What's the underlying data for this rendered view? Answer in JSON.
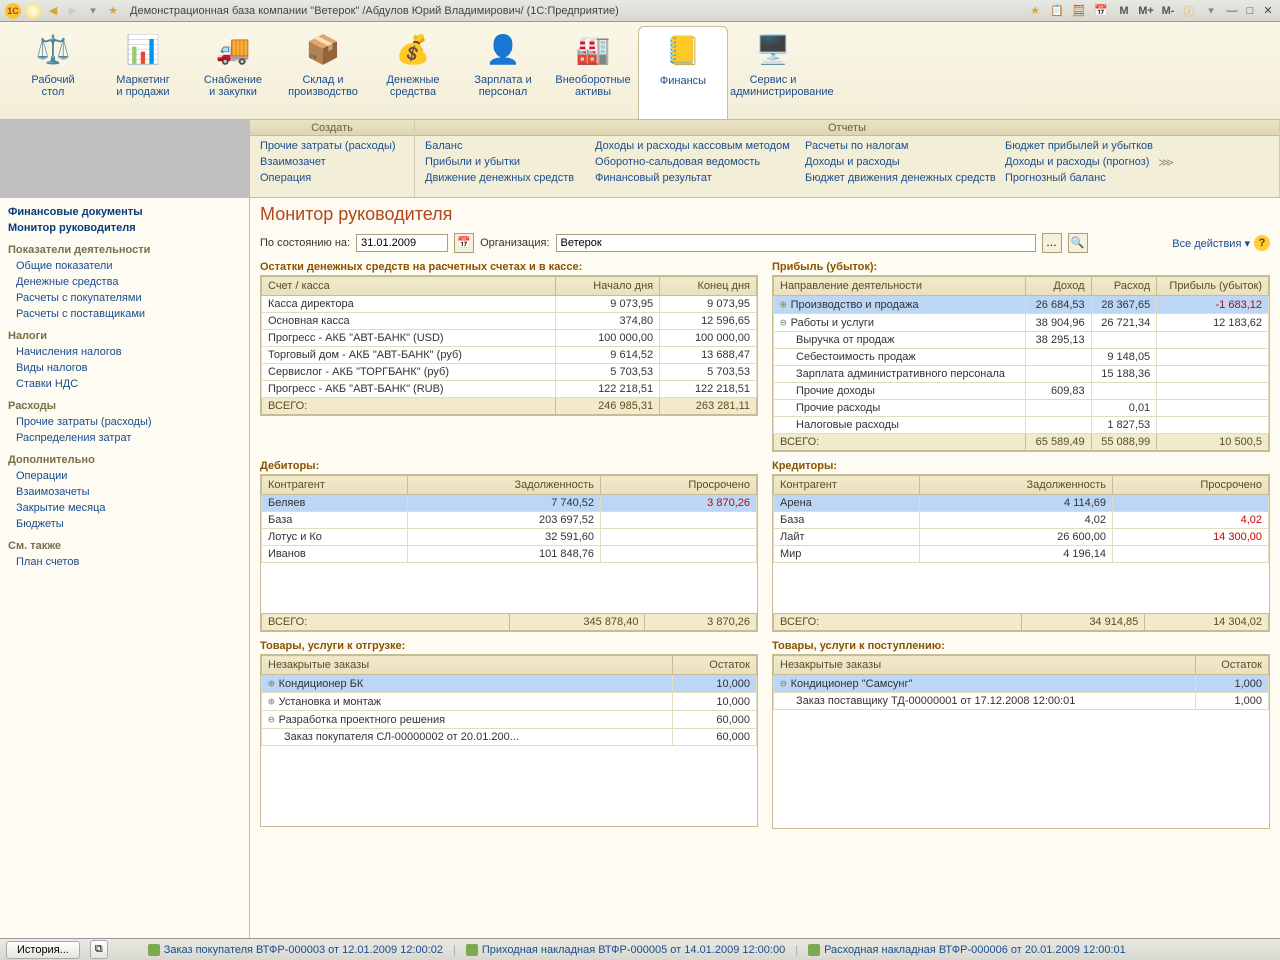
{
  "title": "Демонстрационная база компании \"Ветерок\" /Абдулов Юрий Владимирович/  (1С:Предприятие)",
  "titlebar": {
    "m": "M",
    "mp": "M+",
    "mm": "M-"
  },
  "sections": [
    {
      "label": "Рабочий\nстол",
      "icon": "⚖️"
    },
    {
      "label": "Маркетинг\nи продажи",
      "icon": "📊"
    },
    {
      "label": "Снабжение\nи закупки",
      "icon": "🚚"
    },
    {
      "label": "Склад и\nпроизводство",
      "icon": "📦"
    },
    {
      "label": "Денежные\nсредства",
      "icon": "💰"
    },
    {
      "label": "Зарплата и\nперсонал",
      "icon": "👤"
    },
    {
      "label": "Внеоборотные\nактивы",
      "icon": "🏭"
    },
    {
      "label": "Финансы",
      "icon": "📒"
    },
    {
      "label": "Сервис и\nадминистрирование",
      "icon": "🖥️"
    }
  ],
  "submenu": {
    "create_hdr": "Создать",
    "reports_hdr": "Отчеты",
    "create": [
      "Прочие затраты (расходы)",
      "Взаимозачет",
      "Операция"
    ],
    "reports1": [
      "Баланс",
      "Прибыли и убытки",
      "Движение денежных средств"
    ],
    "reports2": [
      "Доходы и расходы кассовым методом",
      "Оборотно-сальдовая ведомость",
      "Финансовый результат"
    ],
    "reports3": [
      "Расчеты по налогам",
      "Доходы и расходы",
      "Бюджет движения денежных средств"
    ],
    "reports4": [
      "Бюджет прибылей и убытков",
      "Доходы и расходы (прогноз)",
      "Прогнозный баланс"
    ]
  },
  "sidebar": {
    "top": [
      "Финансовые документы",
      "Монитор руководителя"
    ],
    "g1_h": "Показатели деятельности",
    "g1": [
      "Общие показатели",
      "Денежные средства",
      "Расчеты с покупателями",
      "Расчеты с поставщиками"
    ],
    "g2_h": "Налоги",
    "g2": [
      "Начисления налогов",
      "Виды налогов",
      "Ставки НДС"
    ],
    "g3_h": "Расходы",
    "g3": [
      "Прочие затраты (расходы)",
      "Распределения затрат"
    ],
    "g4_h": "Дополнительно",
    "g4": [
      "Операции",
      "Взаимозачеты",
      "Закрытие месяца",
      "Бюджеты"
    ],
    "g5_h": "См. также",
    "g5": [
      "План счетов"
    ]
  },
  "page": {
    "title": "Монитор руководителя",
    "asof_label": "По состоянию на:",
    "date": "31.01.2009",
    "org_label": "Организация:",
    "org": "Ветерок",
    "all_actions": "Все действия"
  },
  "cash": {
    "title": "Остатки денежных средств на расчетных счетах и в кассе:",
    "h": [
      "Счет / касса",
      "Начало дня",
      "Конец дня"
    ],
    "rows": [
      [
        "Касса директора",
        "9 073,95",
        "9 073,95"
      ],
      [
        "Основная касса",
        "374,80",
        "12 596,65"
      ],
      [
        "Прогресс - АКБ \"АВТ-БАНК\" (USD)",
        "100 000,00",
        "100 000,00"
      ],
      [
        "Торговый дом - АКБ \"АВТ-БАНК\" (руб)",
        "9 614,52",
        "13 688,47"
      ],
      [
        "Сервислог - АКБ \"ТОРГБАНК\" (руб)",
        "5 703,53",
        "5 703,53"
      ],
      [
        "Прогресс - АКБ \"АВТ-БАНК\" (RUB)",
        "122 218,51",
        "122 218,51"
      ]
    ],
    "total": [
      "ВСЕГО:",
      "246 985,31",
      "263 281,11"
    ]
  },
  "profit": {
    "title": "Прибыль (убыток):",
    "h": [
      "Направление деятельности",
      "Доход",
      "Расход",
      "Прибыль (убыток)"
    ],
    "rows": [
      {
        "c": [
          "Производство и продажа",
          "26 684,53",
          "28 367,65",
          "-1 683,12"
        ],
        "sel": true,
        "tree": "+",
        "neg": true
      },
      {
        "c": [
          "Работы и услуги",
          "38 904,96",
          "26 721,34",
          "12 183,62"
        ],
        "tree": "-"
      },
      {
        "c": [
          "Выручка от продаж",
          "38 295,13",
          "",
          ""
        ],
        "ind": 1
      },
      {
        "c": [
          "Себестоимость продаж",
          "",
          "9 148,05",
          ""
        ],
        "ind": 1
      },
      {
        "c": [
          "Зарплата административного персонала",
          "",
          "15 188,36",
          ""
        ],
        "ind": 1
      },
      {
        "c": [
          "Прочие доходы",
          "609,83",
          "",
          ""
        ],
        "ind": 1
      },
      {
        "c": [
          "Прочие расходы",
          "",
          "0,01",
          ""
        ],
        "ind": 1
      },
      {
        "c": [
          "Налоговые расходы",
          "",
          "1 827,53",
          ""
        ],
        "ind": 1
      }
    ],
    "total": [
      "ВСЕГО:",
      "65 589,49",
      "55 088,99",
      "10 500,5"
    ]
  },
  "debtors": {
    "title": "Дебиторы:",
    "h": [
      "Контрагент",
      "Задолженность",
      "Просрочено"
    ],
    "rows": [
      {
        "c": [
          "Беляев",
          "7 740,52",
          "3 870,26"
        ],
        "sel": true,
        "neg": true
      },
      {
        "c": [
          "База",
          "203 697,52",
          ""
        ]
      },
      {
        "c": [
          "Лотус и Ко",
          "32 591,60",
          ""
        ]
      },
      {
        "c": [
          "Иванов",
          "101 848,76",
          ""
        ]
      }
    ],
    "total": [
      "ВСЕГО:",
      "345 878,40",
      "3 870,26"
    ]
  },
  "creditors": {
    "title": "Кредиторы:",
    "h": [
      "Контрагент",
      "Задолженность",
      "Просрочено"
    ],
    "rows": [
      {
        "c": [
          "Арена",
          "4 114,69",
          ""
        ],
        "sel": true
      },
      {
        "c": [
          "База",
          "4,02",
          "4,02"
        ],
        "neg": true
      },
      {
        "c": [
          "Лайт",
          "26 600,00",
          "14 300,00"
        ],
        "neg": true
      },
      {
        "c": [
          "Мир",
          "4 196,14",
          ""
        ]
      }
    ],
    "total": [
      "ВСЕГО:",
      "34 914,85",
      "14 304,02"
    ]
  },
  "ship": {
    "title": "Товары, услуги к отгрузке:",
    "h": [
      "Незакрытые заказы",
      "Остаток"
    ],
    "rows": [
      {
        "c": [
          "Кондиционер БК",
          "10,000"
        ],
        "sel": true,
        "tree": "+"
      },
      {
        "c": [
          "Установка и монтаж",
          "10,000"
        ],
        "tree": "+"
      },
      {
        "c": [
          "Разработка проектного решения",
          "60,000"
        ],
        "tree": "-"
      },
      {
        "c": [
          "Заказ покупателя СЛ-00000002 от 20.01.200...",
          "60,000"
        ],
        "ind": 1
      }
    ]
  },
  "recv": {
    "title": "Товары, услуги к поступлению:",
    "h": [
      "Незакрытые заказы",
      "Остаток"
    ],
    "rows": [
      {
        "c": [
          "Кондиционер \"Самсунг\"",
          "1,000"
        ],
        "sel": true,
        "tree": "-"
      },
      {
        "c": [
          "Заказ поставщику ТД-00000001 от 17.12.2008 12:00:01",
          "1,000"
        ],
        "ind": 1
      }
    ]
  },
  "status": {
    "history": "История...",
    "links": [
      "Заказ покупателя ВТФР-000003 от 12.01.2009 12:00:02",
      "Приходная накладная ВТФР-000005 от 14.01.2009 12:00:00",
      "Расходная накладная ВТФР-000006 от 20.01.2009 12:00:01"
    ]
  }
}
